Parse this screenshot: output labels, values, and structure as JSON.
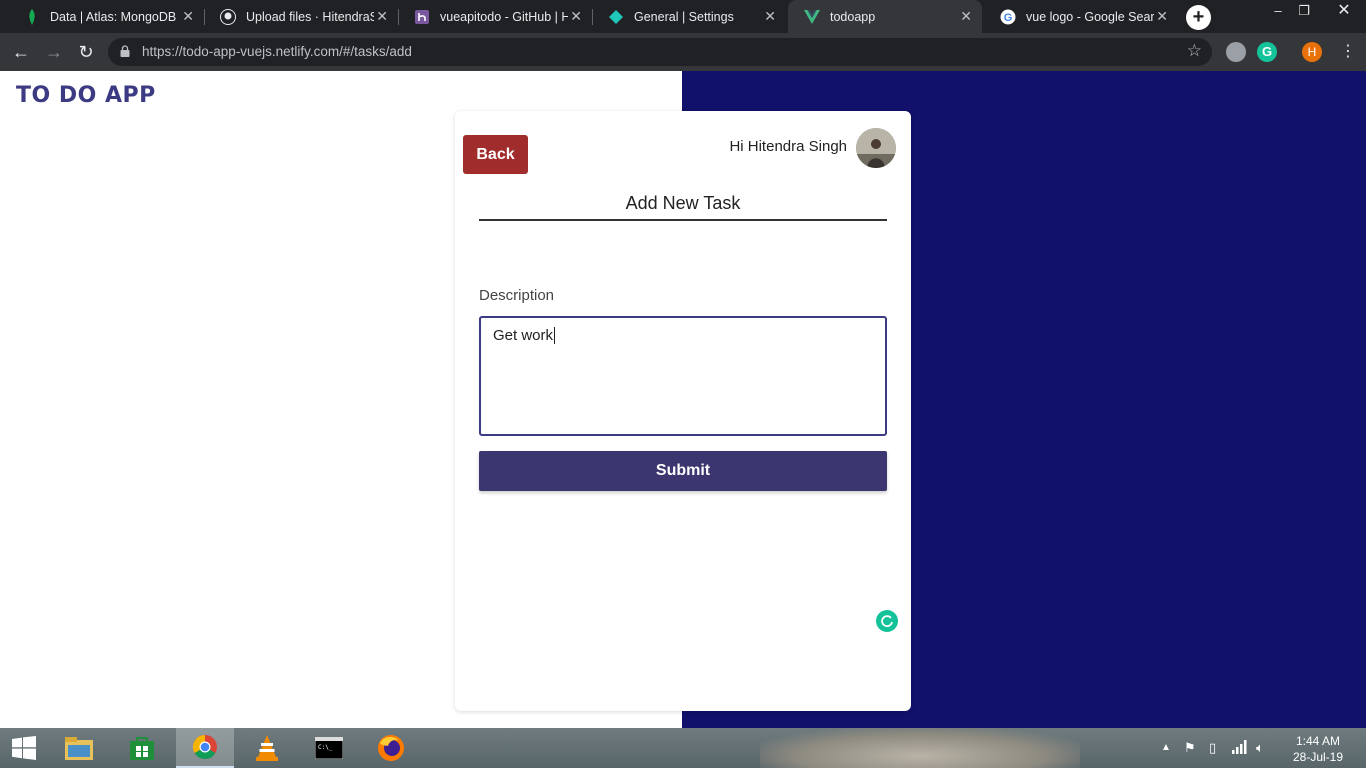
{
  "browser": {
    "tabs": [
      {
        "title": "Data | Atlas: MongoDB A",
        "icon": "mongodb-leaf-icon",
        "active": false
      },
      {
        "title": "Upload files · HitendraSin",
        "icon": "github-icon",
        "active": false
      },
      {
        "title": "vueapitodo - GitHub | He",
        "icon": "heroku-icon",
        "active": false
      },
      {
        "title": "General | Settings",
        "icon": "netlify-icon",
        "active": false
      },
      {
        "title": "todoapp",
        "icon": "vue-icon",
        "active": true
      },
      {
        "title": "vue logo - Google Search",
        "icon": "google-icon",
        "active": false
      }
    ],
    "url": "https://todo-app-vuejs.netlify.com/#/tasks/add",
    "profile_initial": "H"
  },
  "app": {
    "logo": "TO DO APP",
    "back_label": "Back",
    "greeting": "Hi Hitendra Singh",
    "heading": "Add New Task",
    "description_label": "Description",
    "description_value": "Get work",
    "submit_label": "Submit"
  },
  "taskbar": {
    "time": "1:44 AM",
    "date": "28-Jul-19"
  },
  "colors": {
    "navy": "#11106b",
    "brand": "#3c3a82",
    "back": "#a02c2c",
    "submit": "#3c3670"
  }
}
